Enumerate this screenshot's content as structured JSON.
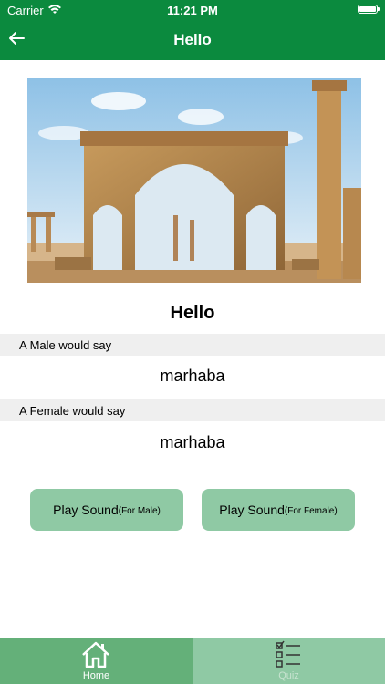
{
  "status_bar": {
    "carrier": "Carrier",
    "time": "11:21 PM"
  },
  "nav": {
    "title": "Hello",
    "back_icon": "arrow-left-icon"
  },
  "phrase": {
    "title": "Hello",
    "male_label": "A Male would say",
    "male_value": "marhaba",
    "female_label": "A Female would say",
    "female_value": "marhaba"
  },
  "buttons": {
    "male_label": "Play Sound",
    "male_sub": "(For Male)",
    "female_label": "Play Sound",
    "female_sub": "(For Female)"
  },
  "tabs": [
    {
      "label": "Home",
      "icon": "home-icon"
    },
    {
      "label": "Quiz",
      "icon": "checklist-icon"
    }
  ],
  "colors": {
    "primary": "#0b8a3e",
    "button": "#8fc9a4",
    "tab_selected": "#64b079"
  }
}
